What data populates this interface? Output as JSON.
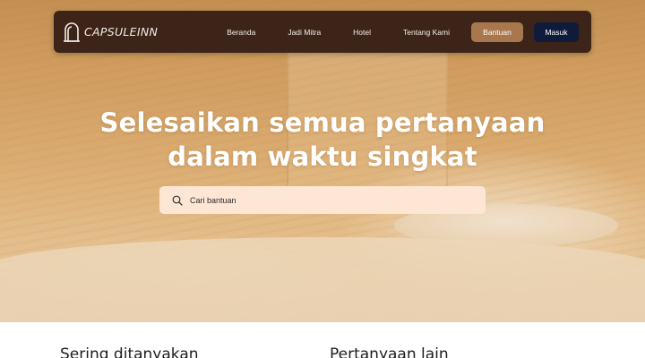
{
  "brand": {
    "name": "CAPSULEINN"
  },
  "nav": {
    "links": [
      "Beranda",
      "Jadi Mitra",
      "Hotel",
      "Tentang Kami"
    ],
    "help_button": "Bantuan",
    "login_button": "Masuk"
  },
  "hero": {
    "headline_line1": "Selesaikan semua pertanyaan",
    "headline_line2": "dalam waktu singkat"
  },
  "search": {
    "placeholder": "Cari bantuan",
    "value": ""
  },
  "sections": {
    "faq_title": "Sering ditanyakan",
    "other_title": "Pertanyaan lain"
  },
  "colors": {
    "navbar": "#3d2419",
    "help_button": "#a9774d",
    "login_button": "#101a3a",
    "search_bg": "#fde6d4"
  }
}
